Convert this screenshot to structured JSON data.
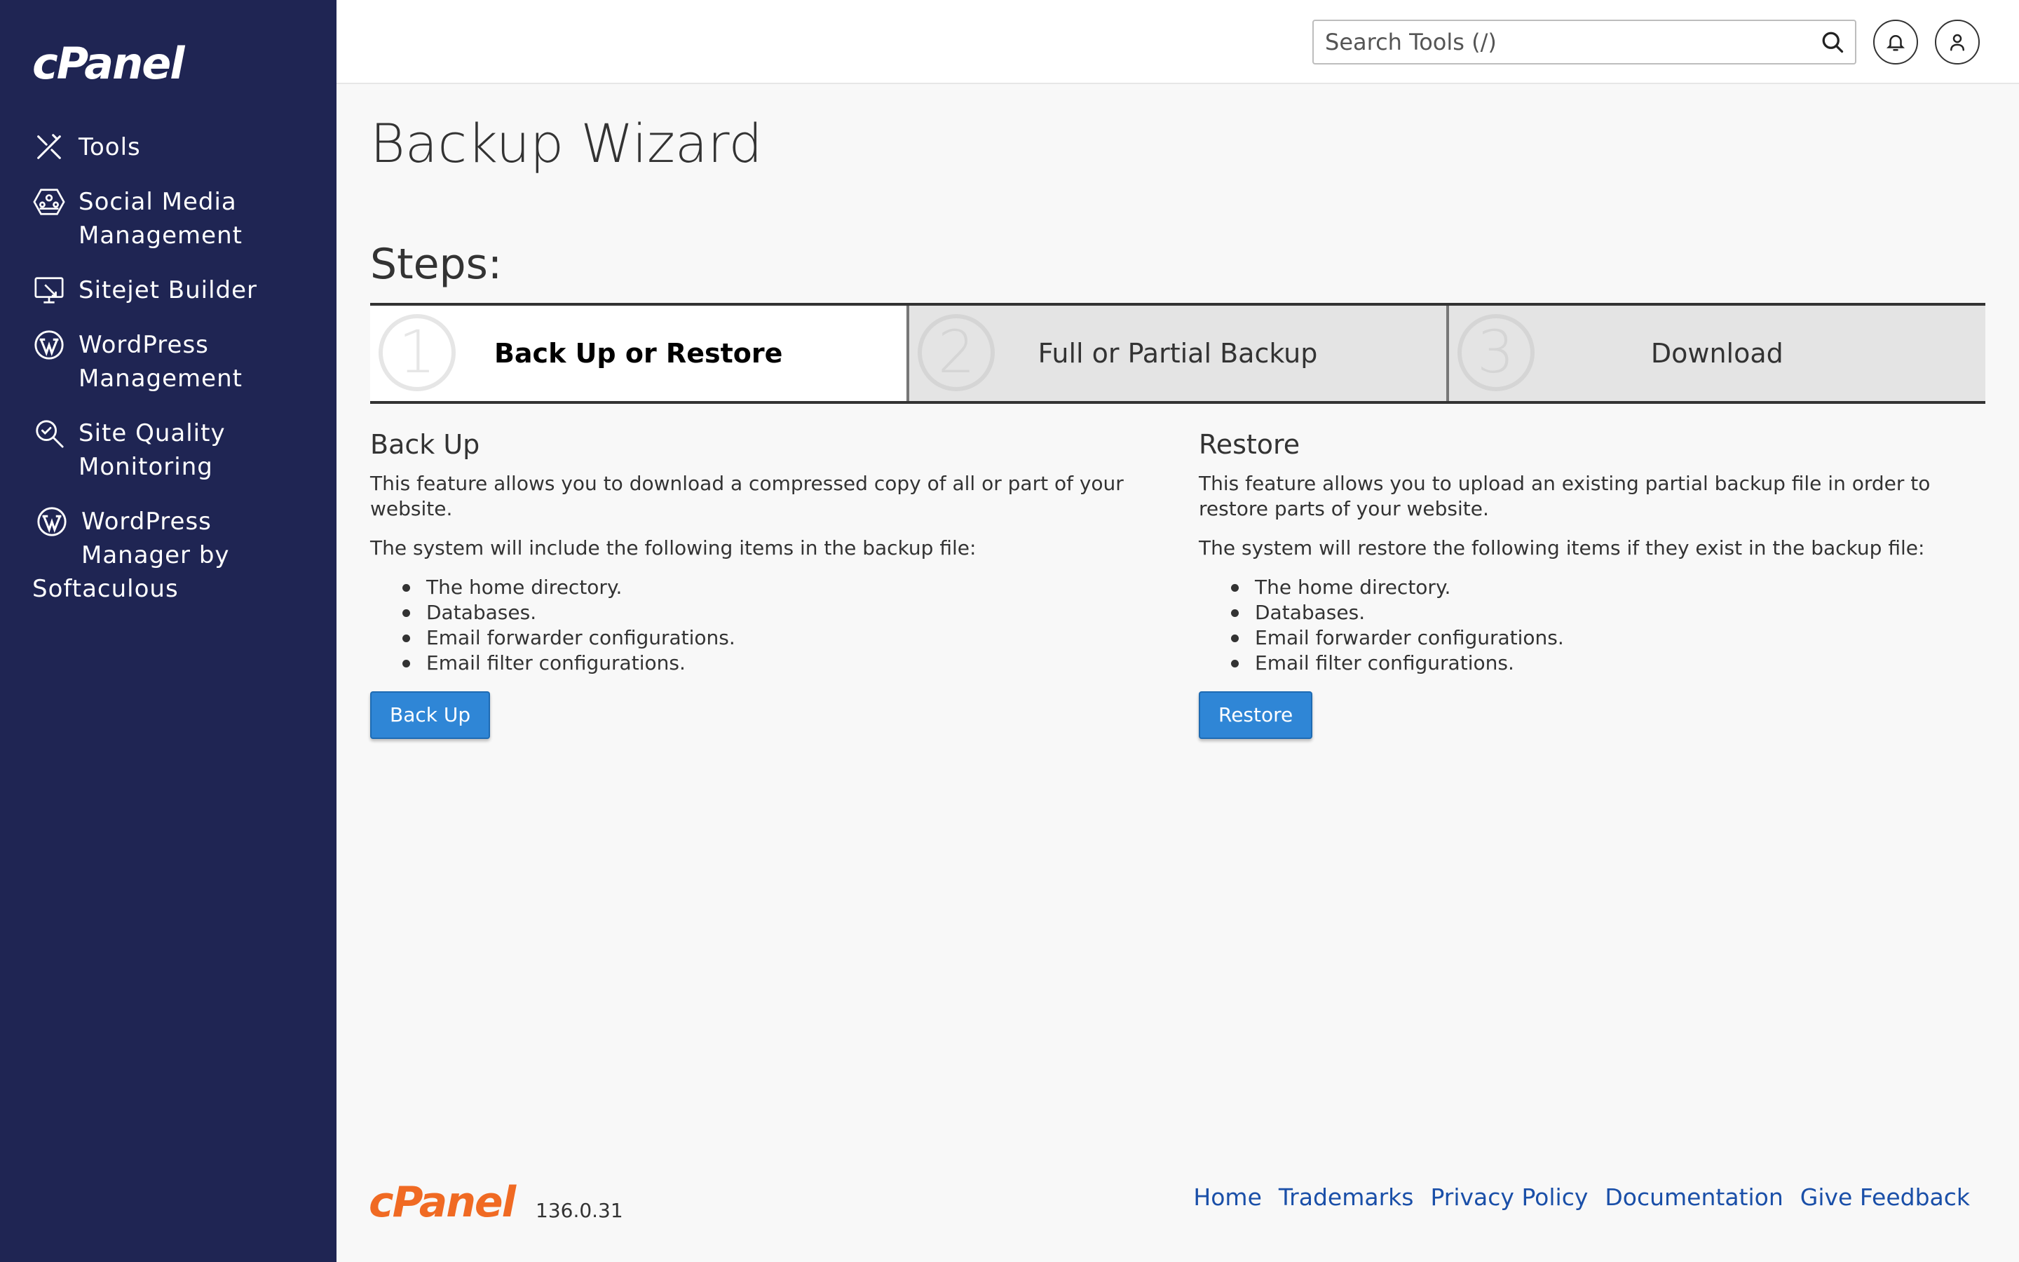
{
  "brand": {
    "name": "cPanel",
    "version": "136.0.31",
    "accent": "#f06a23",
    "sidebar_bg": "#1f2553",
    "button_color": "#2f86d6"
  },
  "sidebar": {
    "items": [
      {
        "label": "Tools",
        "icon": "tools-icon"
      },
      {
        "label": "Social Media Management",
        "line1": "Social Media",
        "line2": "Management",
        "icon": "social-media-icon"
      },
      {
        "label": "Sitejet Builder",
        "icon": "sitejet-icon"
      },
      {
        "label": "WordPress Management",
        "line1": "WordPress",
        "line2": "Management",
        "icon": "wordpress-icon"
      },
      {
        "label": "Site Quality Monitoring",
        "line1": "Site Quality",
        "line2": "Monitoring",
        "icon": "site-quality-icon"
      },
      {
        "label": "WordPress Manager by Softaculous",
        "line1": "WordPress",
        "line2": "Manager by",
        "line3": "Softaculous",
        "icon": "wordpress-icon"
      }
    ]
  },
  "header": {
    "search_placeholder": "Search Tools (/)",
    "search_value": ""
  },
  "page": {
    "title": "Backup Wizard",
    "steps_title": "Steps:",
    "steps": [
      {
        "num": "1",
        "label": "Back Up or Restore",
        "active": true
      },
      {
        "num": "2",
        "label": "Full or Partial Backup",
        "active": false
      },
      {
        "num": "3",
        "label": "Download",
        "active": false
      }
    ]
  },
  "backup": {
    "heading": "Back Up",
    "desc": "This feature allows you to download a compressed copy of all or part of your website.",
    "list_intro": "The system will include the following items in the backup file:",
    "items": [
      "The home directory.",
      "Databases.",
      "Email forwarder configurations.",
      "Email filter configurations."
    ],
    "button": "Back Up"
  },
  "restore": {
    "heading": "Restore",
    "desc": "This feature allows you to upload an existing partial backup file in order to restore parts of your website.",
    "list_intro": "The system will restore the following items if they exist in the backup file:",
    "items": [
      "The home directory.",
      "Databases.",
      "Email forwarder configurations.",
      "Email filter configurations."
    ],
    "button": "Restore"
  },
  "footer": {
    "links": [
      "Home",
      "Trademarks",
      "Privacy Policy",
      "Documentation",
      "Give Feedback"
    ]
  }
}
